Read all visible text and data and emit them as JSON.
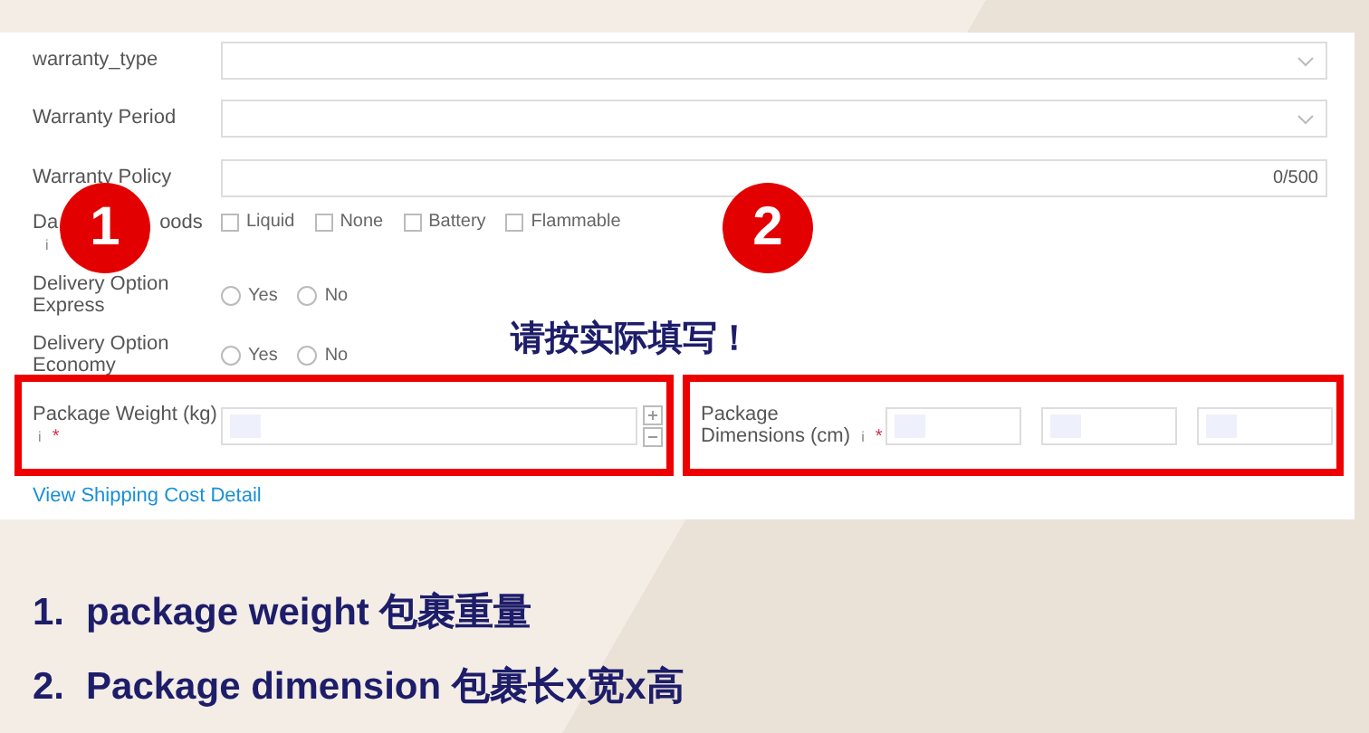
{
  "form": {
    "rows": [
      {
        "kind": "select",
        "label": "warranty_type"
      },
      {
        "kind": "select",
        "label": "Warranty Period"
      },
      {
        "kind": "textarea",
        "label": "Warranty Policy",
        "counter": "0/500"
      },
      {
        "kind": "checkboxes",
        "label_parts": [
          "Da",
          "oods"
        ],
        "info": "i",
        "options": [
          {
            "label": "Liquid",
            "checked": false
          },
          {
            "label": "None",
            "checked": false
          },
          {
            "label": "Battery",
            "checked": false
          },
          {
            "label": "Flammable",
            "checked": false
          }
        ]
      },
      {
        "kind": "radios",
        "label": "Delivery Option Express",
        "options": [
          {
            "label": "Yes",
            "selected": false
          },
          {
            "label": "No",
            "selected": false
          }
        ]
      },
      {
        "kind": "radios",
        "label": "Delivery Option Economy",
        "options": [
          {
            "label": "Yes",
            "selected": false
          },
          {
            "label": "No",
            "selected": false
          }
        ]
      }
    ],
    "weight": {
      "label": "Package Weight (kg)",
      "info": "i",
      "required": "*"
    },
    "dimensions": {
      "label": "Package Dimensions (cm)",
      "info": "i",
      "required": "*"
    },
    "link": "View Shipping Cost Detail"
  },
  "badges": [
    "1",
    "2"
  ],
  "notice": "请按实际填写！",
  "notes": [
    {
      "number": "1.",
      "text": "package weight 包裹重量"
    },
    {
      "number": "2.",
      "text": "Package dimension 包裹长x宽x高"
    }
  ]
}
